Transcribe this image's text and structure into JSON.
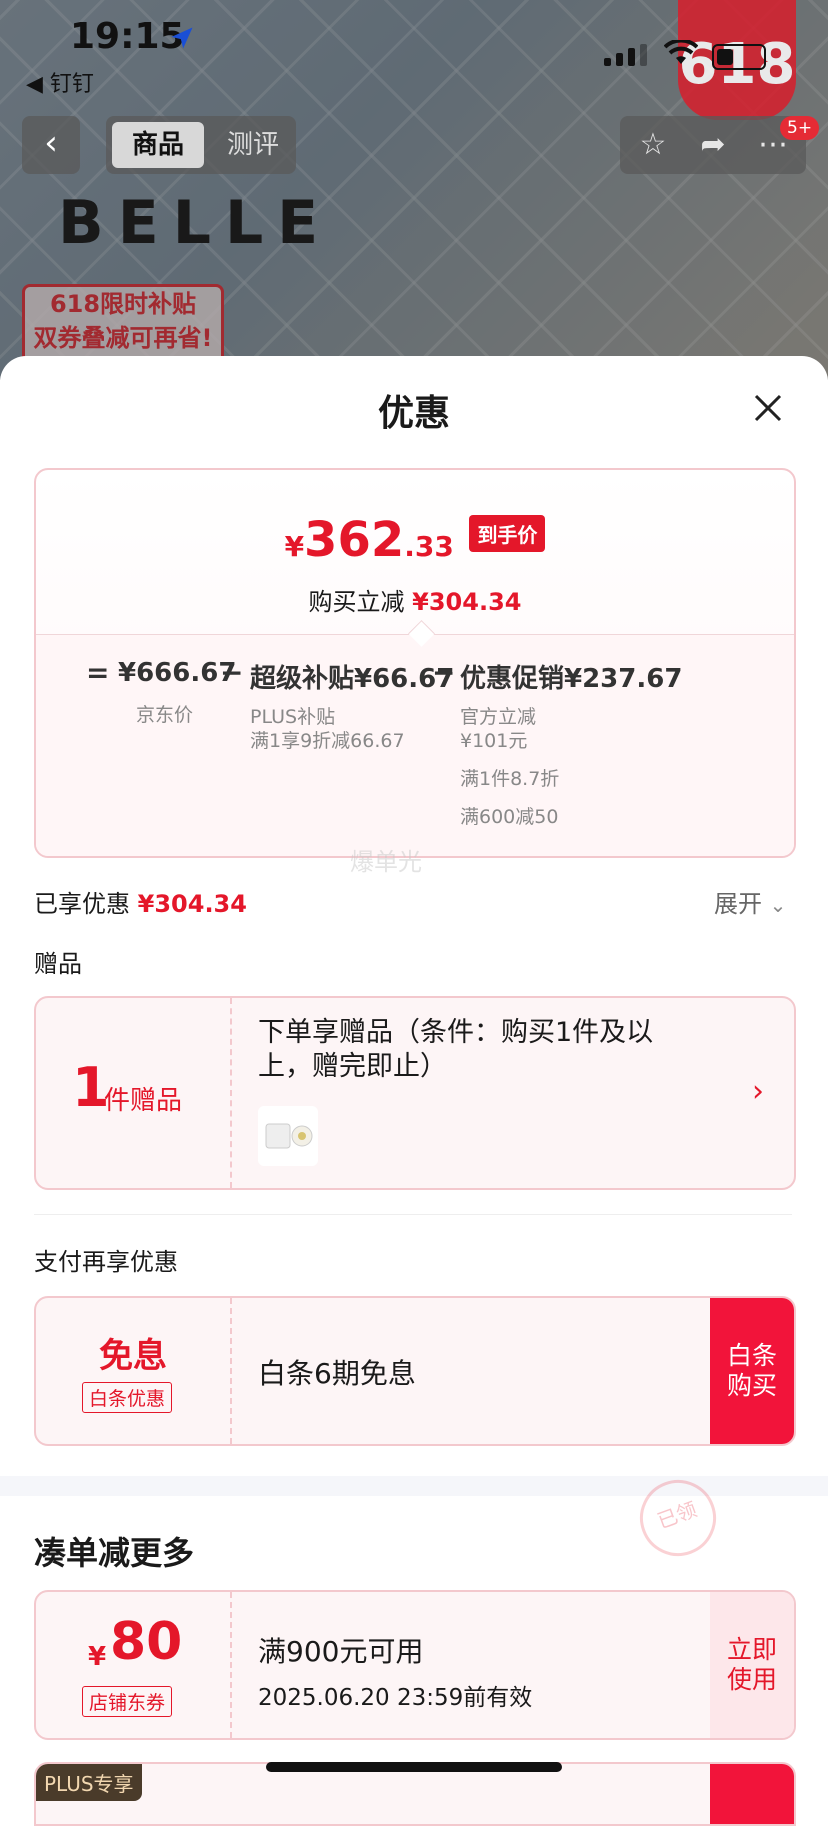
{
  "status_bar": {
    "time": "19:15",
    "back_app": "◀ 钉钉",
    "battery_icon": "battery-icon"
  },
  "product_page": {
    "badge_618": "618",
    "tabs": [
      {
        "label": "商品"
      },
      {
        "label": "测评"
      }
    ],
    "notif_badge": "5+",
    "brand": "BELLE",
    "promo": {
      "line1": "618限时补贴",
      "line2": "双券叠减可再省!"
    }
  },
  "sheet": {
    "title": "优惠",
    "price_card": {
      "final_yen": "¥",
      "final_int": "362",
      "final_dec": ".33",
      "final_tag": "到手价",
      "reduce_label": "购买立减",
      "reduce_amount": "¥304.34",
      "breakdown": [
        {
          "op": "=",
          "value": "¥666.67",
          "label": "京东价",
          "subs": []
        },
        {
          "op": "−",
          "value": "超级补贴¥66.67",
          "label": "PLUS补贴",
          "subs": [
            "满1享9折减66.67"
          ]
        },
        {
          "op": "−",
          "value": "优惠促销¥237.67",
          "label": "官方立减",
          "subs": [
            "¥101元",
            "满1件8.7折",
            "满600减50"
          ]
        }
      ],
      "watermark": "爆单光"
    },
    "enjoyed": {
      "label": "已享优惠",
      "amount": "¥304.34",
      "expand": "展开"
    },
    "gift_section": {
      "title": "赠品",
      "count": "1",
      "unit": "件赠品",
      "text": "下单享赠品（条件：购买1件及以上，赠完即止）"
    },
    "pay_section": {
      "title": "支付再享优惠",
      "main": "免息",
      "tag": "白条优惠",
      "text": "白条6期免息",
      "button": [
        "白条",
        "购买"
      ]
    },
    "more_section": {
      "title": "凑单减更多",
      "coupon": {
        "yen": "¥",
        "amount": "80",
        "tag": "店铺东券",
        "condition": "满900元可用",
        "valid": "2025.06.20 23:59前有效",
        "button": [
          "立即",
          "使用"
        ],
        "stamp": "已领"
      },
      "next_tag": "PLUS专享"
    }
  },
  "colors": {
    "accent": "#e4172a",
    "button_red": "#f2143a",
    "border_pink": "#f3c8cd"
  }
}
